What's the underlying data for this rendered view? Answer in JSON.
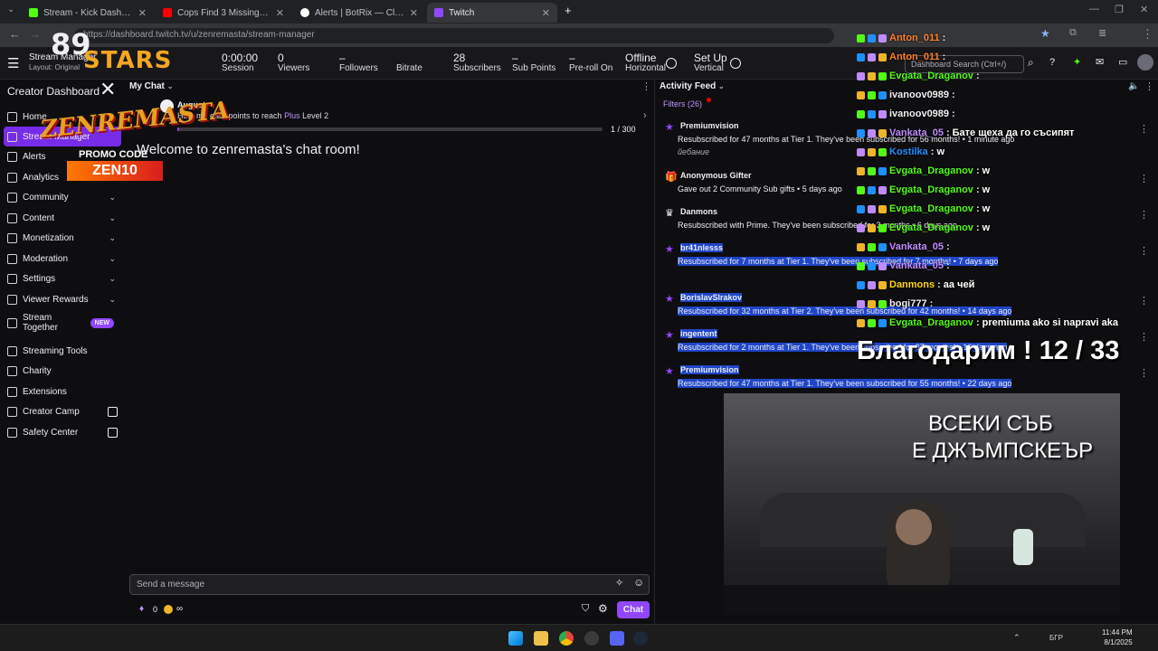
{
  "browser": {
    "tabs": [
      {
        "title": "Stream - Kick Dashboard",
        "color": "#53fc18"
      },
      {
        "title": "Cops Find 3 Missing Kids Trapp…",
        "color": "#ff0000"
      },
      {
        "title": "Alerts | BotRix — Cloud Stream…",
        "color": "#ffffff"
      },
      {
        "title": "Twitch",
        "color": "#9147ff"
      }
    ],
    "new_tab": "+",
    "url": "https://dashboard.twitch.tv/u/zenremasta/stream-manager"
  },
  "topbar": {
    "page_title": "Stream Manager",
    "layout_label": "Layout: Original",
    "stats": [
      {
        "value": "0:00:00",
        "label": "Session"
      },
      {
        "value": "0",
        "label": "Viewers"
      },
      {
        "value": "–",
        "label": "Followers"
      },
      {
        "value": "",
        "label": "Bitrate"
      },
      {
        "value": "28",
        "label": "Subscribers"
      },
      {
        "value": "–",
        "label": "Sub Points"
      },
      {
        "value": "–",
        "label": "Pre-roll On"
      }
    ],
    "offline": {
      "value": "Offline",
      "label": "Horizontal"
    },
    "setup": {
      "value": "Set Up",
      "label": "Vertical"
    },
    "search_placeholder": "Dashboard Search (Ctrl+/)"
  },
  "sidebar": {
    "title": "Creator Dashboard",
    "items": [
      {
        "label": "Home",
        "chevron": false
      },
      {
        "label": "Stream Manager",
        "chevron": false
      },
      {
        "label": "Alerts",
        "chevron": false
      },
      {
        "label": "Analytics",
        "chevron": true
      },
      {
        "label": "Community",
        "chevron": true
      },
      {
        "label": "Content",
        "chevron": true
      },
      {
        "label": "Monetization",
        "chevron": true
      },
      {
        "label": "Moderation",
        "chevron": true
      },
      {
        "label": "Settings",
        "chevron": true
      },
      {
        "label": "Viewer Rewards",
        "chevron": true
      },
      {
        "label": "Stream Together",
        "badge": "NEW"
      },
      {
        "label": "Streaming Tools",
        "chevron": false
      },
      {
        "label": "Charity",
        "chevron": false
      },
      {
        "label": "Extensions",
        "chevron": false
      },
      {
        "label": "Creator Camp",
        "external": true
      },
      {
        "label": "Safety Center",
        "external": true
      }
    ]
  },
  "chat": {
    "panel_title": "My Chat",
    "month": "August",
    "points_text_pre": "Help me earn points to reach",
    "points_plus": "Plus",
    "points_text_post": "Level 2",
    "progress": "1 / 300",
    "progress_fraction": 0.0033,
    "welcome": "Welcome to zenremasta's chat room!",
    "input_placeholder": "Send a message",
    "points_count": "0",
    "infinity": "∞",
    "chat_button": "Chat"
  },
  "activity": {
    "title": "Activity Feed",
    "filters": "Filters (26)",
    "items": [
      {
        "name": "Premiumvision",
        "desc": "Resubscribed for 47 months at Tier 1. They've been subscribed for 56 months! • 1 minute ago",
        "extra": "йебание",
        "icon": "star",
        "selected": false
      },
      {
        "name": "Anonymous Gifter",
        "desc": "Gave out 2 Community Sub gifts • 5 days ago",
        "icon": "gift",
        "selected": false
      },
      {
        "name": "Danmons",
        "desc": "Resubscribed with Prime. They've been subscribed for 3 months • 6 days ago",
        "icon": "crown",
        "selected": false
      },
      {
        "name": "br41nlesss",
        "desc": "Resubscribed for 7 months at Tier 1. They've been subscribed for 7 months! • 7 days ago",
        "icon": "star",
        "selected": true
      },
      {
        "name": "BorislavSlrakov",
        "desc": "Resubscribed for 32 months at Tier 2. They've been subscribed for 42 months! • 14 days ago",
        "icon": "star",
        "selected": true
      },
      {
        "name": "ingentent",
        "desc": "Resubscribed for 2 months at Tier 1. They've been subscribed for 37 months! • 16 days ago",
        "icon": "star",
        "selected": true
      },
      {
        "name": "Premiumvision",
        "desc": "Resubscribed for 47 months at Tier 1. They've been subscribed for 55 months! • 22 days ago",
        "icon": "star",
        "selected": true
      }
    ]
  },
  "overlay": {
    "logo_stars": "STARS",
    "logo_number": "89",
    "brand": "ZENREMASTA",
    "promo": "PROMO CODE",
    "code": "ZEN10",
    "thanks": "Благодарим ! 12 / 33",
    "caption_line1": "ВСЕКИ СЪБ",
    "caption_line2": "Е ДЖЪМПСКЕЪР",
    "chat": [
      {
        "user": "Anton_011",
        "msg": "",
        "color": "#ff7f27"
      },
      {
        "user": "Anton_011",
        "msg": "",
        "color": "#ff7f27"
      },
      {
        "user": "Evgata_Draganov",
        "msg": "",
        "color": "#53fc18"
      },
      {
        "user": "ivanoov0989",
        "msg": "",
        "color": "#efeff1"
      },
      {
        "user": "ivanoov0989",
        "msg": "",
        "color": "#efeff1"
      },
      {
        "user": "Vankata_05",
        "msg": "Бате щеха да го съсипят",
        "color": "#c08bff"
      },
      {
        "user": "Kostilka",
        "msg": "w",
        "color": "#1e90ff"
      },
      {
        "user": "Evgata_Draganov",
        "msg": "w",
        "color": "#53fc18"
      },
      {
        "user": "Evgata_Draganov",
        "msg": "w",
        "color": "#53fc18"
      },
      {
        "user": "Evgata_Draganov",
        "msg": "w",
        "color": "#53fc18"
      },
      {
        "user": "Evgata_Draganov",
        "msg": "w",
        "color": "#53fc18"
      },
      {
        "user": "Vankata_05",
        "msg": "",
        "color": "#c08bff"
      },
      {
        "user": "Vankata_05",
        "msg": "",
        "color": "#c08bff"
      },
      {
        "user": "Danmons",
        "msg": "аа чей",
        "color": "#ffd700"
      },
      {
        "user": "bogi777",
        "msg": "",
        "color": "#efeff1"
      },
      {
        "user": "Evgata_Draganov",
        "msg": "premiuma ako si napravi aka",
        "color": "#53fc18"
      }
    ]
  },
  "taskbar": {
    "lang": "БГР",
    "time": "11:44 PM",
    "date": "8/1/2025"
  }
}
